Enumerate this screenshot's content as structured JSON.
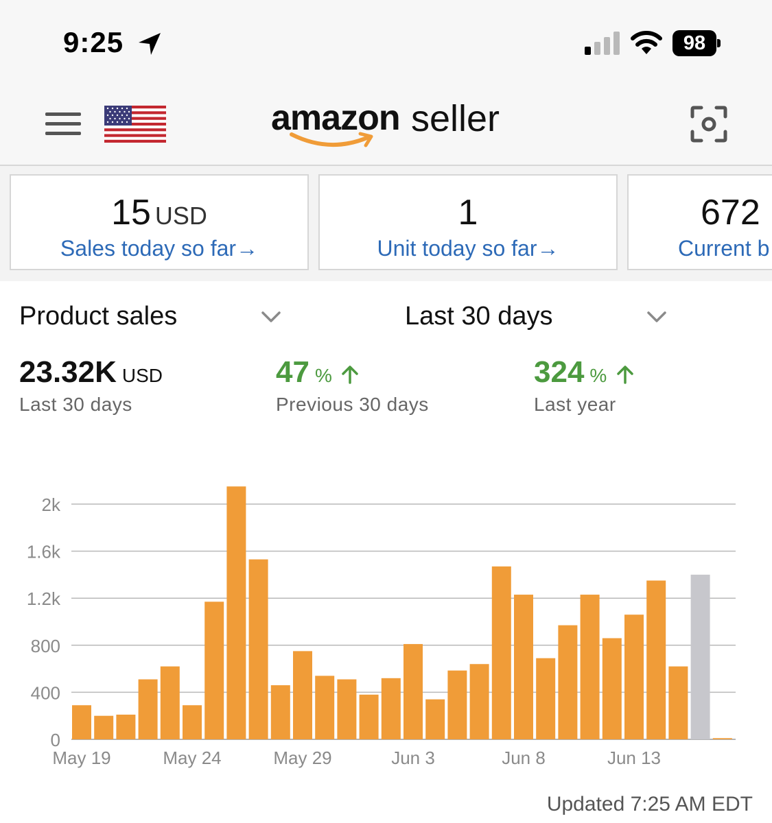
{
  "status_bar": {
    "time": "9:25",
    "battery": "98"
  },
  "header": {
    "logo_amazon": "amazon",
    "logo_seller": "seller",
    "icons": [
      "menu-icon",
      "us-flag-icon",
      "scan-icon"
    ]
  },
  "cards": [
    {
      "value": "15",
      "unit": "USD",
      "label": "Sales today so far",
      "arrow": "→"
    },
    {
      "value": "1",
      "unit": "",
      "label": "Unit today so far",
      "arrow": "→"
    },
    {
      "value": "672",
      "unit": "",
      "label": "Current b",
      "arrow": ""
    }
  ],
  "filters": {
    "metric": "Product sales",
    "period": "Last 30 days"
  },
  "stats": [
    {
      "value": "23.32K",
      "unit": "USD",
      "label": "Last 30 days"
    },
    {
      "value": "47",
      "unit": "%",
      "label": "Previous 30 days"
    },
    {
      "value": "324",
      "unit": "%",
      "label": "Last year"
    }
  ],
  "colors": {
    "bar": "#f09c38",
    "bar_current": "#c7c7cc",
    "link": "#2d6ab7",
    "positive": "#4c9a3f"
  },
  "chart_data": {
    "type": "bar",
    "categories": [
      "May 19",
      "May 20",
      "May 21",
      "May 22",
      "May 23",
      "May 24",
      "May 25",
      "May 26",
      "May 27",
      "May 28",
      "May 29",
      "May 30",
      "May 31",
      "Jun 1",
      "Jun 2",
      "Jun 3",
      "Jun 4",
      "Jun 5",
      "Jun 6",
      "Jun 7",
      "Jun 8",
      "Jun 9",
      "Jun 10",
      "Jun 11",
      "Jun 12",
      "Jun 13",
      "Jun 14",
      "Jun 15",
      "Jun 16",
      "Jun 17"
    ],
    "values": [
      290,
      200,
      210,
      510,
      620,
      290,
      1170,
      2150,
      1530,
      460,
      750,
      540,
      510,
      380,
      520,
      810,
      340,
      585,
      640,
      1470,
      1230,
      690,
      970,
      1230,
      860,
      1060,
      1350,
      620,
      1400,
      10
    ],
    "current_index": 28,
    "xticks": [
      "May 19",
      "May 24",
      "May 29",
      "Jun 3",
      "Jun 8",
      "Jun 13"
    ],
    "xtick_indices": [
      0,
      5,
      10,
      15,
      20,
      25
    ],
    "yticks": [
      "0",
      "400",
      "800",
      "1.2k",
      "1.6k",
      "2k"
    ],
    "ytick_values": [
      0,
      400,
      800,
      1200,
      1600,
      2000
    ],
    "ylim": [
      0,
      2150
    ],
    "grid": true
  },
  "footer": {
    "updated": "Updated 7:25 AM EDT"
  }
}
